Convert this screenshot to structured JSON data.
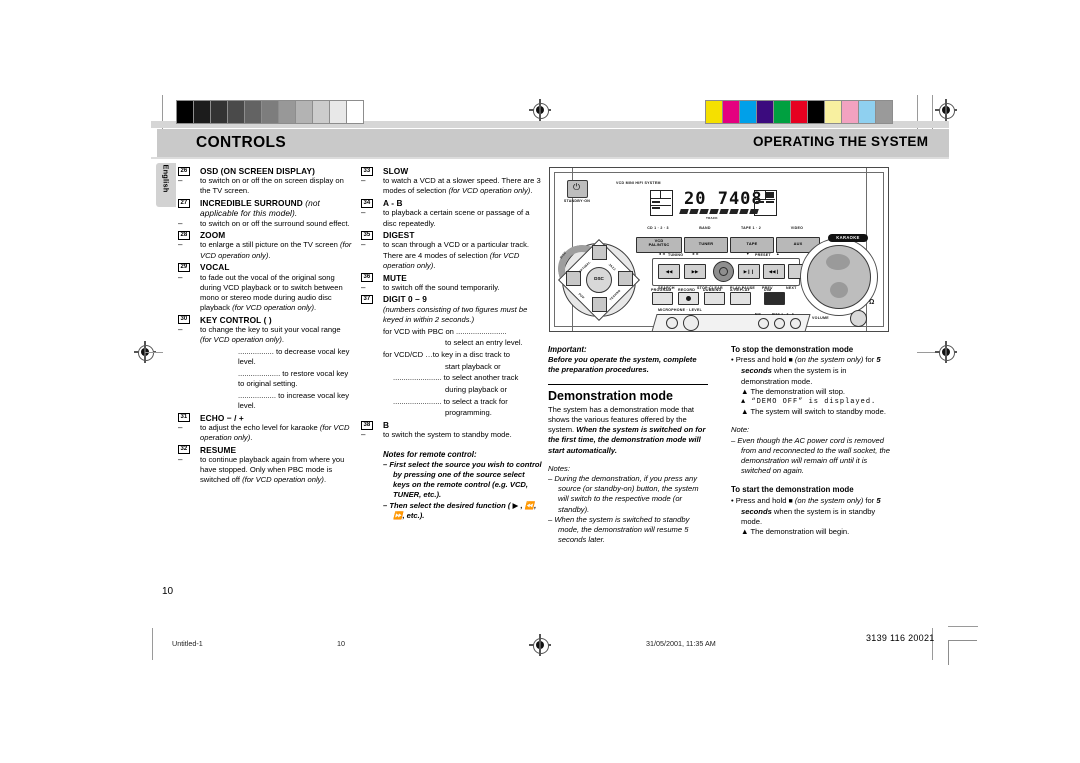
{
  "header": {
    "left_title": "CONTROLS",
    "right_title": "OPERATING THE SYSTEM",
    "language_tab": "English"
  },
  "page_number": "10",
  "footer": {
    "file": "Untitled-1",
    "page": "10",
    "timestamp": "31/05/2001, 11:35 AM",
    "doc_code": "3139 116 20021"
  },
  "column1": {
    "items": [
      {
        "num": "26",
        "title": "OSD (ON SCREEN DISPLAY)",
        "title_note": "",
        "body": [
          "to switch on or off the on screen display on the TV screen."
        ]
      },
      {
        "num": "27",
        "title": "INCREDIBLE SURROUND",
        "title_note": "(not applicable for this model).",
        "body": [
          "to switch on or off the surround sound effect."
        ]
      },
      {
        "num": "28",
        "title": "ZOOM",
        "title_note": "",
        "body": [
          "to enlarge a still picture on the TV screen (for VCD operation only)."
        ]
      },
      {
        "num": "29",
        "title": "VOCAL",
        "title_note": "",
        "body": [
          "to fade out the vocal of the original song during VCD playback or to switch between mono or stereo mode during audio disc playback (for VCD operation only)."
        ]
      },
      {
        "num": "30",
        "title": "KEY CONTROL  (            )",
        "title_note": "",
        "body": [
          "to change the key to suit your vocal range (for VCD operation only)."
        ],
        "sub": [
          {
            "lead": ".................",
            "text": "to decrease vocal key level."
          },
          {
            "lead": "....................",
            "text": "to restore vocal key to original setting."
          },
          {
            "lead": "..................",
            "text": "to increase vocal key level."
          }
        ]
      },
      {
        "num": "31",
        "title": "ECHO  − / +",
        "title_note": "",
        "body": [
          "to adjust the echo level for karaoke (for VCD operation only)."
        ]
      },
      {
        "num": "32",
        "title": "RESUME",
        "title_note": "",
        "body": [
          "to continue playback again from where you have stopped. Only when PBC mode is switched off (for VCD operation only)."
        ]
      }
    ]
  },
  "column2": {
    "items": [
      {
        "num": "33",
        "title": "SLOW",
        "body": [
          "to watch a VCD at a slower speed. There are 3 modes of selection (for VCD operation only)."
        ]
      },
      {
        "num": "34",
        "title": "A - B",
        "body": [
          "to playback a certain scene or passage of a disc repeatedly."
        ]
      },
      {
        "num": "35",
        "title": "DIGEST",
        "body": [
          "to scan through a VCD or a particular track. There are 4 modes of selection (for VCD operation only)."
        ]
      },
      {
        "num": "36",
        "title": "MUTE",
        "body": [
          "to switch off the sound temporarily."
        ]
      },
      {
        "num": "37",
        "title": "DIGIT  0 – 9",
        "italic_note": "(numbers consisting of two figures must be keyed in within 2 seconds.)",
        "lines": [
          {
            "text": "for VCD with PBC on ........................",
            "indent": 0
          },
          {
            "text": "to select an entry level.",
            "indent": 62
          },
          {
            "text": "for VCD/CD …to key in a disc track to",
            "indent": 0
          },
          {
            "text": "start playback or",
            "indent": 62
          },
          {
            "text": "....................... to select another track",
            "indent": 10
          },
          {
            "text": "during playback or",
            "indent": 62
          },
          {
            "text": "....................... to select a track for",
            "indent": 10
          },
          {
            "text": "programming.",
            "indent": 62
          }
        ]
      },
      {
        "num": "38",
        "title": "B",
        "body": [
          "to switch the system to standby mode."
        ]
      }
    ],
    "notes_title": "Notes for remote control:",
    "notes": [
      "First select the source you wish to control by pressing one of the source select keys on the remote control (e.g.  VCD, TUNER, etc.).",
      "Then select the desired function ( ▶ ,  ⏪,  ⏩,  etc.)."
    ]
  },
  "column3": {
    "important_title": "Important:",
    "important_body": "Before you operate the system, complete the preparation procedures.",
    "section_title": "Demonstration mode",
    "paragraph_plain": "The system has a demonstration mode that shows the various features offered by the system.",
    "paragraph_bold": "When the system is switched on for the first time, the demonstration mode will start automatically.",
    "notes_label": "Notes:",
    "notes": [
      "During the demonstration, if you press any source (or standby-on) button, the system will switch to the respective mode (or standby).",
      "When the system is switched to standby mode, the demonstration will resume 5 seconds later."
    ]
  },
  "column4": {
    "stop_title": "To stop the demonstration mode",
    "stop_bullet_parts": {
      "a": "Press and hold ",
      "square": "■",
      "b": " (on the system only)",
      "c": " for ",
      "bold": "5 seconds",
      "d": " when the system is in demonstration mode."
    },
    "stop_results": [
      "The demonstration will stop.",
      "“DEMO  OFF” is displayed.",
      "The system will switch to standby mode."
    ],
    "note_label": "Note:",
    "note_body": "Even though the AC power cord is removed from and reconnected to the wall socket, the demonstration will remain off until it is switched on again.",
    "start_title": "To start the demonstration mode",
    "start_bullet_parts": {
      "a": "Press and hold ",
      "square": "■",
      "b": " (on the system only)",
      "c": " for ",
      "bold": "5 seconds",
      "d": " when the system is in standby mode."
    },
    "start_results": [
      "The demonstration will begin."
    ]
  },
  "illustration": {
    "model_text": "VCD MINI HIFI SYSTEM",
    "standby_label": "STANDBY·ON",
    "display_value": "20   7408",
    "display_sub": "TRACK",
    "brand": "KARAOKE",
    "source_headers": [
      "CD 1 · 2 · 3",
      "BAND",
      "TAPE 1 · 2",
      "VIDEO"
    ],
    "source_buttons": [
      "VCD\nPAL/NTSC",
      "TUNER",
      "TAPE",
      "AUX"
    ],
    "tuning_label": "TUNING",
    "preset_label": "PRESET",
    "transport_labels": [
      "SEARCH",
      "STOP·CLEAR",
      "PLAY·PAUSE",
      "PREV",
      "NEXT"
    ],
    "function_labels": [
      "PROGRAM",
      "RECORD",
      "DUBBING",
      "A·REPLAY",
      "DIM"
    ],
    "mic_label": "MICROPHONE · LEVEL",
    "jack_labels": [
      "MIC",
      "DISC 1 · 2 · 3"
    ],
    "volume_label": "VOLUME",
    "disc_label": "DISC",
    "dsc_center": "DSC",
    "dsc_pads": [
      "OPTIMAL",
      "JAZZ",
      "TECHNO",
      "POP",
      "ROCK"
    ]
  },
  "calibration": {
    "gray_steps": [
      "#000000",
      "#1c1c1c",
      "#333333",
      "#4a4a4a",
      "#636363",
      "#7d7d7d",
      "#989898",
      "#b3b3b3",
      "#cccccc",
      "#e8e8e8",
      "#ffffff"
    ],
    "color_bars": [
      "#f5e000",
      "#e4007f",
      "#00a0e9",
      "#3b0b7e",
      "#00a040",
      "#e60020",
      "#000000",
      "#f8f0a0",
      "#f2a2c0",
      "#8fd0f0",
      "#9a9a9a"
    ]
  }
}
